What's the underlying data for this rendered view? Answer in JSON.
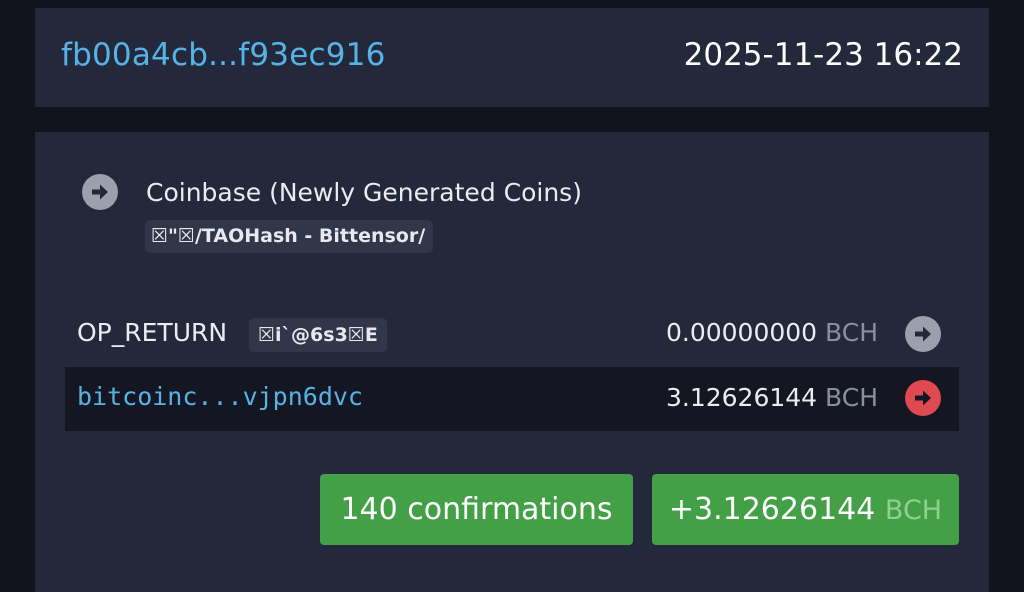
{
  "header": {
    "txid": "fb00a4cb...f93ec916",
    "timestamp": "2025-11-23 16:22"
  },
  "inputs": {
    "icon": "arrow-right-circle-icon",
    "title": "Coinbase (Newly Generated Coins)",
    "script": "☒\"☒/TAOHash - Bittensor/"
  },
  "outputs": [
    {
      "type": "OP_RETURN",
      "label": "OP_RETURN",
      "data": "☒i`@6s3☒E",
      "amount": "0.00000000",
      "unit": "BCH",
      "icon": "arrow-right-circle-icon",
      "icon_color": "#9aa0ac"
    },
    {
      "type": "address",
      "address": "bitcoinc...vjpn6dvc",
      "amount": "3.12626144",
      "unit": "BCH",
      "icon": "arrow-right-circle-icon",
      "icon_color": "#e0494f"
    }
  ],
  "footer": {
    "confirmations": "140 confirmations",
    "total_amount": "+3.12626144",
    "total_unit": "BCH"
  },
  "colors": {
    "background": "#11131d",
    "card": "#24283b",
    "link": "#57b3e6",
    "success": "#43a047",
    "spent": "#e0494f"
  }
}
